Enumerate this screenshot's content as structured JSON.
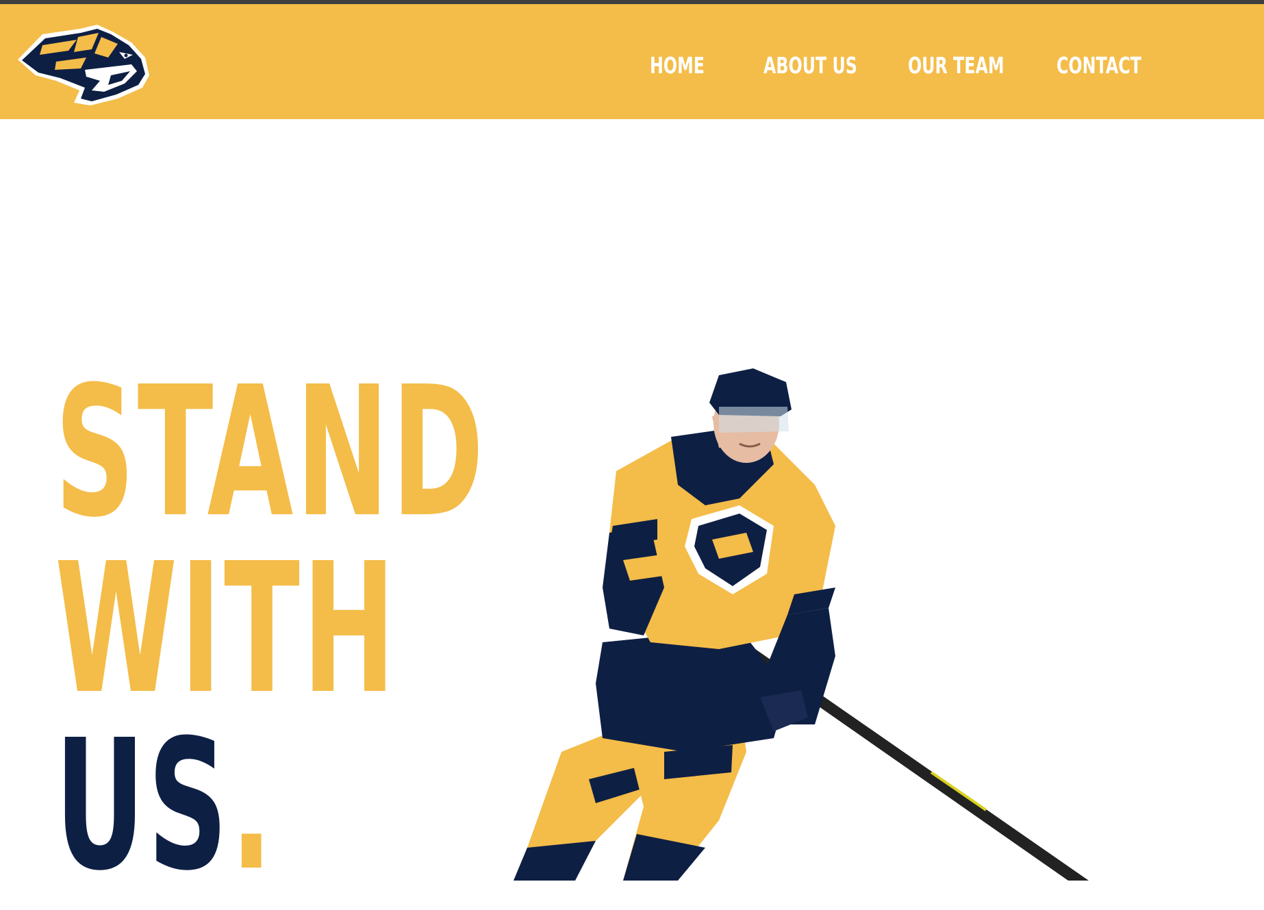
{
  "brand": {
    "logo_icon": "predator-sabertooth-logo-icon",
    "colors": {
      "gold": "#f4bc48",
      "navy": "#0e1f44",
      "topbar": "#3f3f3f",
      "white": "#ffffff"
    }
  },
  "nav": {
    "items": [
      {
        "label": "HOME"
      },
      {
        "label": "ABOUT US"
      },
      {
        "label": "OUR TEAM"
      },
      {
        "label": "CONTACT"
      }
    ]
  },
  "hero": {
    "line1": "STAND",
    "line2": "WITH",
    "line3_main": "US",
    "line3_accent": ".",
    "image_icon": "hockey-player-image"
  }
}
